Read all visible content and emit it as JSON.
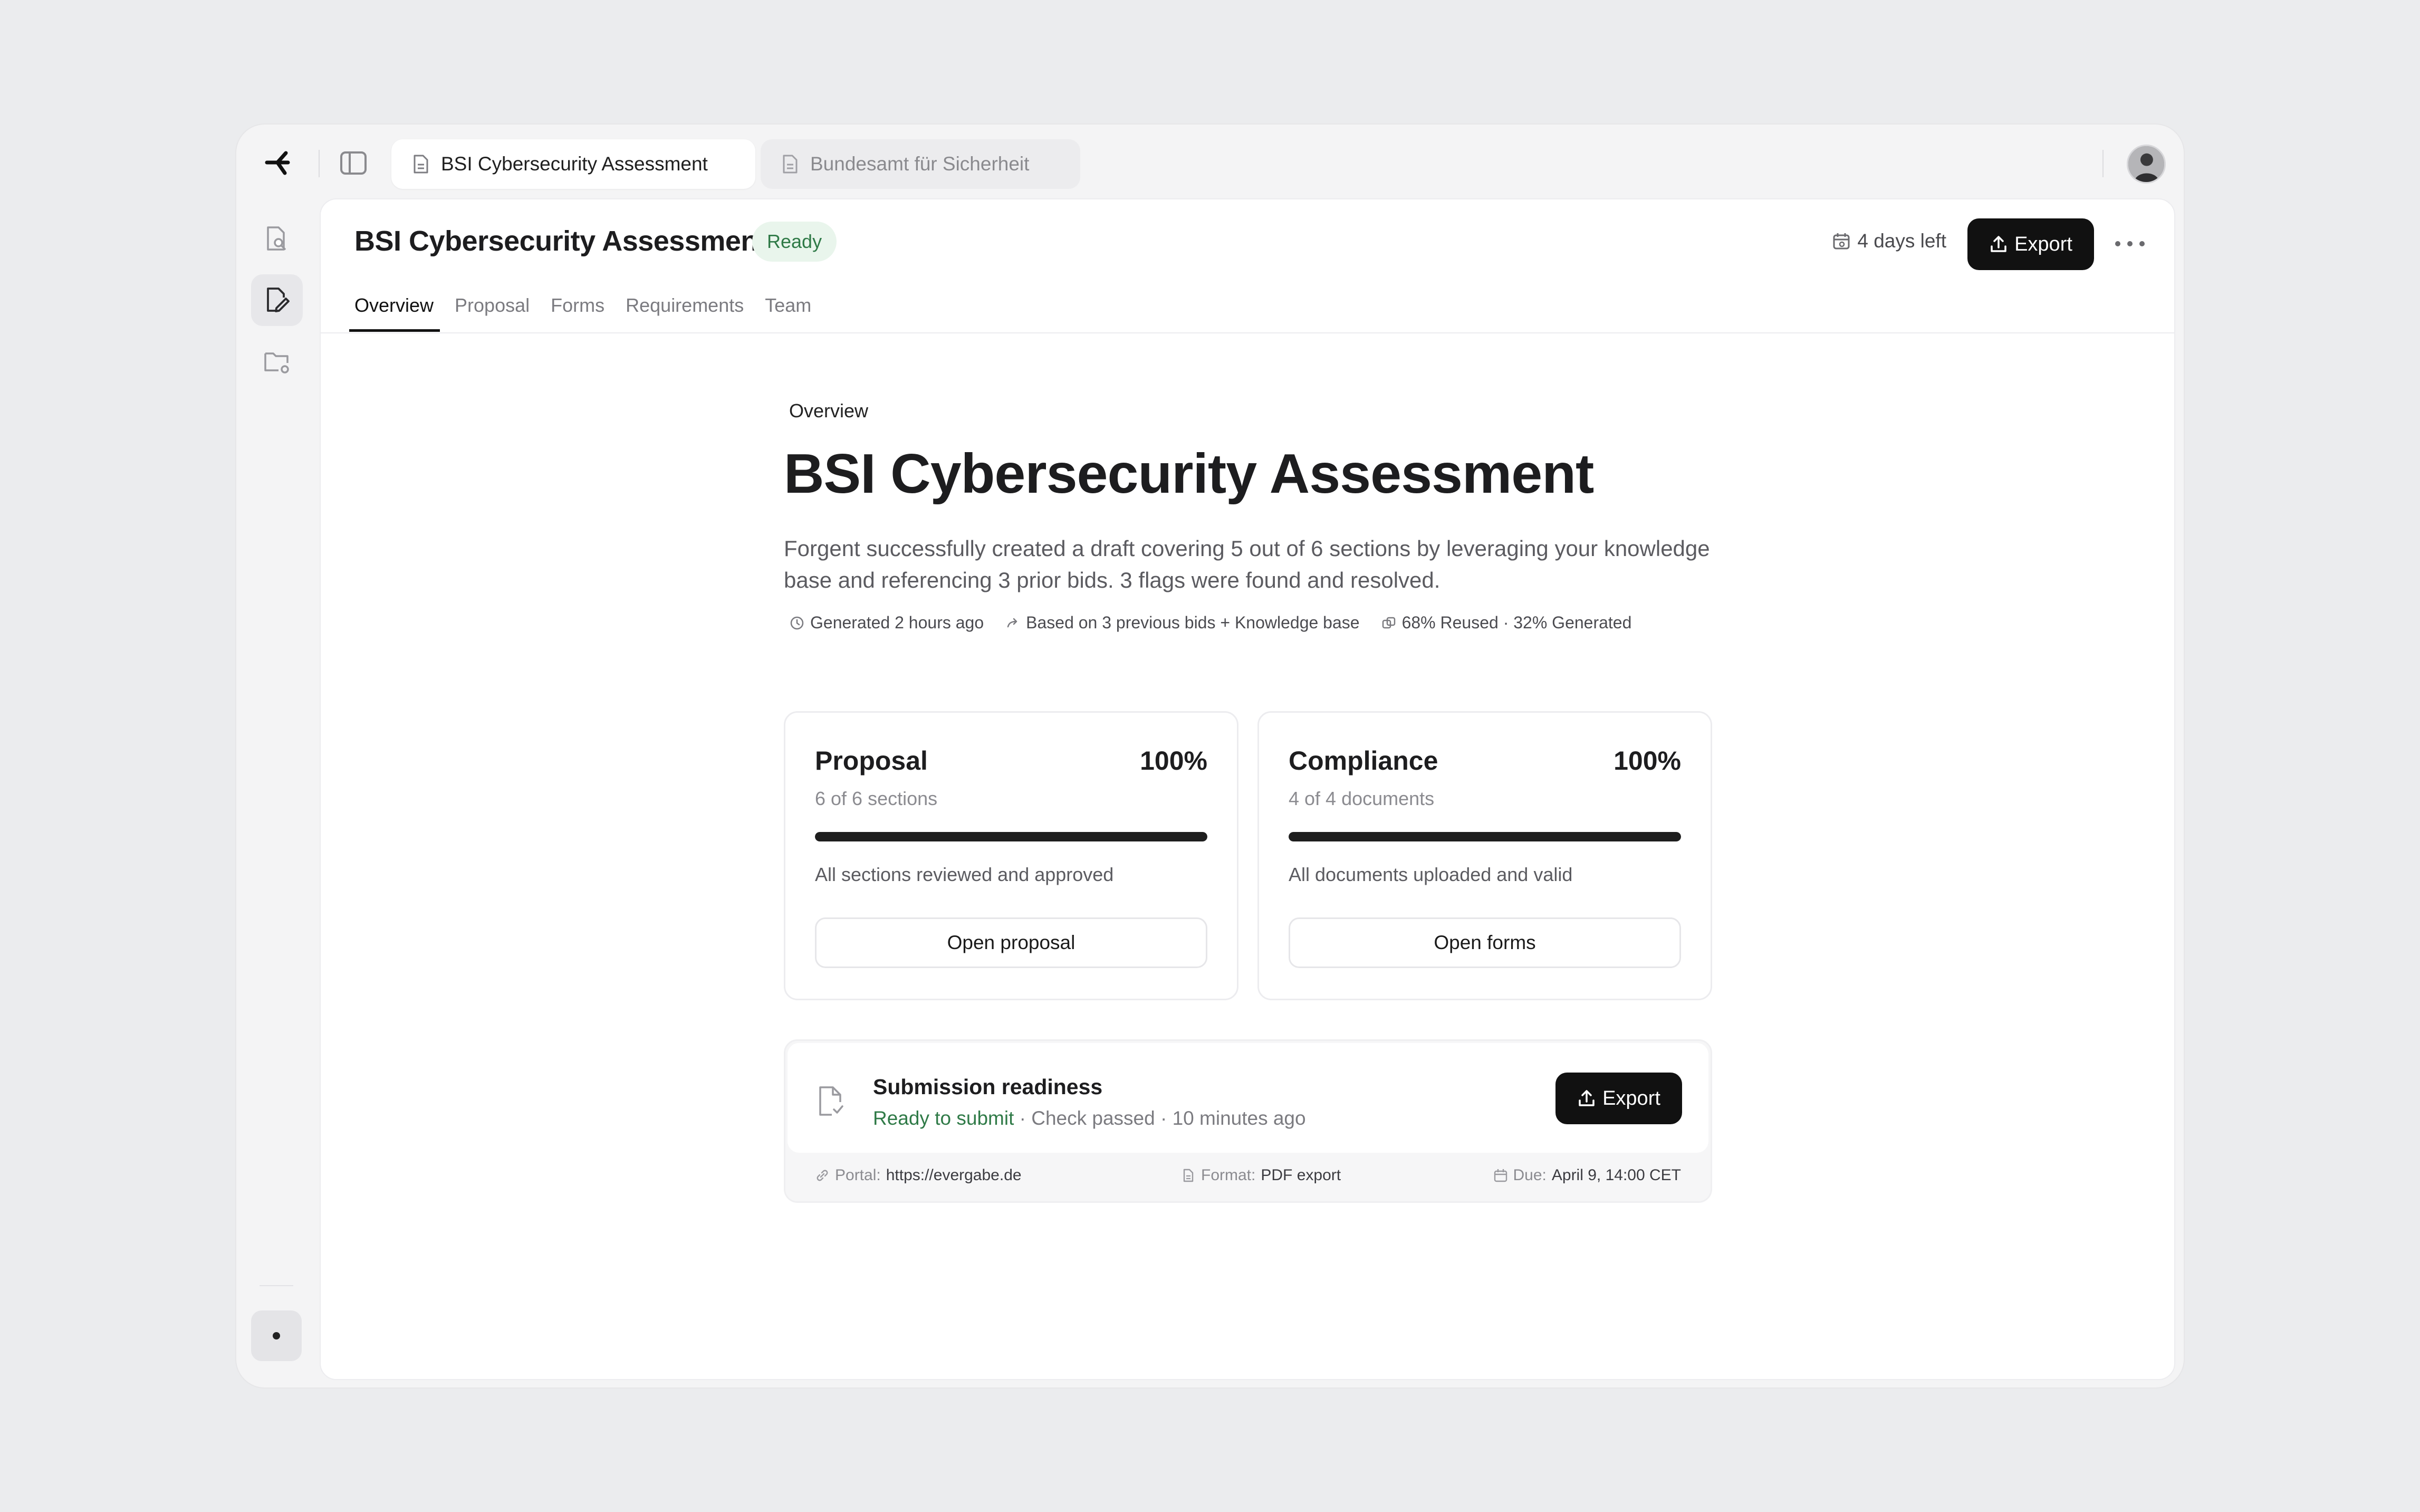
{
  "tabs": [
    {
      "label": "BSI Cybersecurity Assessment",
      "active": true
    },
    {
      "label": "Bundesamt für Sicherheit",
      "active": false
    }
  ],
  "header": {
    "title": "BSI Cybersecurity Assessment",
    "status_badge": "Ready",
    "days_left": "4 days left",
    "export_label": "Export"
  },
  "subnav": [
    "Overview",
    "Proposal",
    "Forms",
    "Requirements",
    "Team"
  ],
  "overview": {
    "eyebrow": "Overview",
    "title": "BSI Cybersecurity Assessment",
    "description": "Forgent successfully created a draft covering 5 out of 6 sections by leveraging your knowledge base and referencing 3 prior bids. 3 flags were found and resolved.",
    "meta": {
      "generated": "Generated 2 hours ago",
      "based_on": "Based on 3 previous bids + Knowledge base",
      "reuse": "68% Reused · 32% Generated"
    }
  },
  "cards": [
    {
      "title": "Proposal",
      "percent": "100%",
      "progress": 1.0,
      "subtitle": "6 of 6 sections",
      "note": "All sections reviewed and approved",
      "button": "Open proposal"
    },
    {
      "title": "Compliance",
      "percent": "100%",
      "progress": 1.0,
      "subtitle": "4 of 4 documents",
      "note": "All documents uploaded and valid",
      "button": "Open forms"
    }
  ],
  "submission": {
    "title": "Submission readiness",
    "status_ok": "Ready to submit",
    "status_rest": " · Check passed · 10 minutes ago",
    "export_label": "Export",
    "portal_key": "Portal:",
    "portal_value": "https://evergabe.de",
    "format_key": "Format:",
    "format_value": "PDF export",
    "due_key": "Due:",
    "due_value": "April 9, 14:00 CET"
  },
  "colors": {
    "accent_dark": "#111111",
    "ready_green": "#2f7a47",
    "ready_bg": "#e9f5ec"
  }
}
